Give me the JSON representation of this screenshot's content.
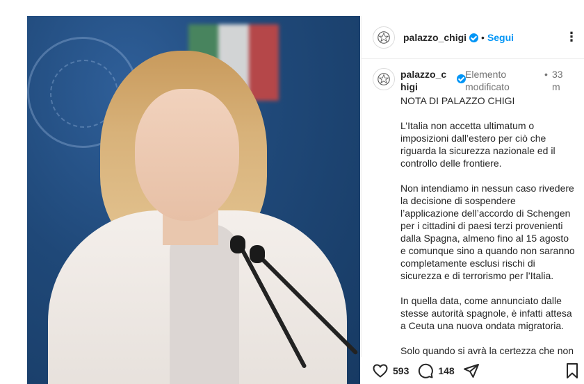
{
  "post": {
    "photo_alt": "Post photo",
    "header": {
      "username": "palazzo_chigi",
      "separator": "•",
      "follow_label": "Segui",
      "more_label": "⋮"
    },
    "caption": {
      "username": "palazzo_chigi",
      "edited_label": "Elemento modificato",
      "separator": "•",
      "time": "33 m",
      "paragraphs": [
        "NOTA DI PALAZZO CHIGI",
        "L’Italia non accetta ultimatum o imposizioni dall’estero per ciò che riguarda la sicurezza nazionale ed il controllo delle frontiere.",
        "Non intendiamo in nessun caso rivedere la decisione di sospendere l’applicazione dell’accordo di Schengen per i cittadini di paesi terzi provenienti dalla Spagna, almeno fino al 15 agosto e comunque sino a quando non saranno completamente esclusi rischi di sicurezza e di terrorismo per l’Italia.",
        "In quella data, come annunciato dalle stesse autorità spagnole, è infatti attesa a Ceuta una nuova ondata migratoria.",
        "Solo quando si avrà la certezza che non"
      ]
    },
    "actions": {
      "likes": "593",
      "comments": "148",
      "icons": [
        "heart-icon",
        "comment-icon",
        "share-icon",
        "bookmark-icon"
      ]
    }
  },
  "colors": {
    "accent": "#0095f6",
    "muted": "#737373",
    "text": "#262626"
  }
}
